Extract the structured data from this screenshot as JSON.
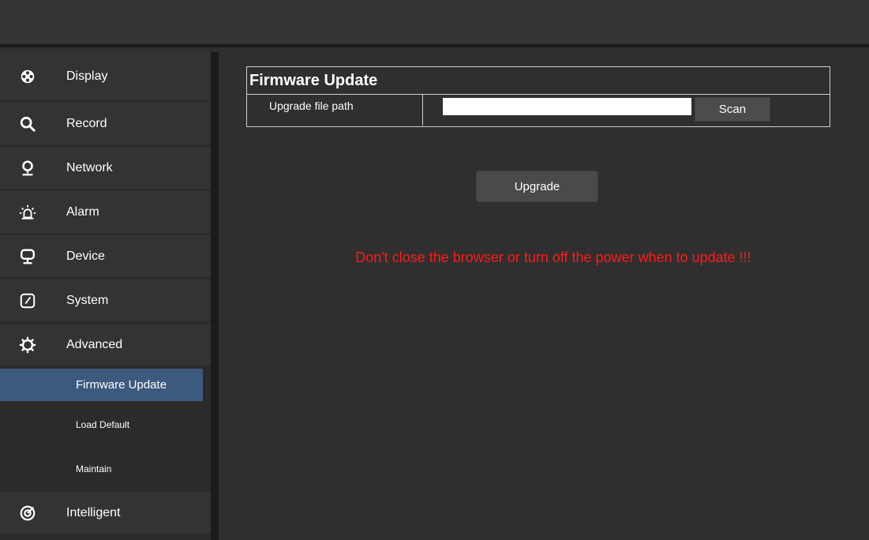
{
  "sidebar": {
    "items": [
      {
        "label": "Display",
        "icon": "display-icon"
      },
      {
        "label": "Record",
        "icon": "search-icon"
      },
      {
        "label": "Network",
        "icon": "location-pin-icon"
      },
      {
        "label": "Alarm",
        "icon": "alarm-light-icon"
      },
      {
        "label": "Device",
        "icon": "monitor-icon"
      },
      {
        "label": "System",
        "icon": "system-gauge-icon"
      },
      {
        "label": "Advanced",
        "icon": "gear-icon"
      }
    ],
    "sub_items": [
      {
        "label": "Firmware Update",
        "active": true
      },
      {
        "label": "Load Default",
        "active": false
      },
      {
        "label": "Maintain",
        "active": false
      }
    ],
    "bottom_item": {
      "label": "Intelligent",
      "icon": "target-icon"
    }
  },
  "main": {
    "panel_title": "Firmware Update",
    "row_label": "Upgrade file path",
    "path_value": "",
    "scan_label": "Scan",
    "upgrade_label": "Upgrade",
    "warning": "Don't close the browser or turn off the power when to update !!!"
  },
  "colors": {
    "active_bg": "#3b5a7e",
    "warning": "#ff1a1a"
  }
}
